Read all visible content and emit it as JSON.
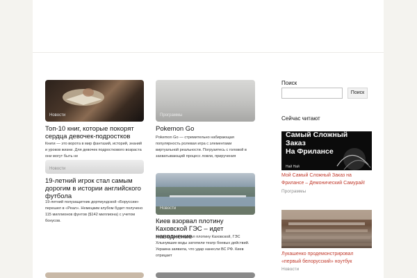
{
  "articles": [
    {
      "category": "Новости",
      "title": "Топ-10 книг, которые покорят сердца девочек-подростков",
      "excerpt": "Книги — это ворота в мир фантазий, историй, знаний и уроков жизни. Для девочек подросткового возраста они могут быть не"
    },
    {
      "category": "Программы",
      "title": "Pokemon Go",
      "excerpt": "Pokemon Go — стремительно набирающая популярность ролевая игра с элементами виртуальной реальности. Погрузитесь с головой в захватывающий процесс ловли, приручения"
    },
    {
      "category": "Новости",
      "title": "19-летний игрок стал самым дорогим в истории английского футбола",
      "excerpt": "19-летний полузащитник дортмундской «Боруссии» перешел в «Реал». Немецким клубом будет получено 115 миллионов фунтов ($142 миллиона) с учетом бонусов."
    },
    {
      "category": "Новости",
      "title": "Киев взорвал плотину Каховской ГЭС – идет наводнение",
      "excerpt": "Киев сегодня взорвал плотину Каховской, ГЭС Хлынувшие воды затопили театр боевых действий. Украина заявила, что удар нанесли ВС РФ. Киев отрицает"
    }
  ],
  "sidebar": {
    "search_heading": "Поиск",
    "search_placeholder": "",
    "search_button": "Поиск",
    "reading_heading": "Сейчас читают",
    "items": [
      {
        "image_text_line1": "Самый Сложный",
        "image_text_line2": "Заказ",
        "image_text_line3": "На Фрилансе",
        "image_caption": "Най Най",
        "title": "Мой Самый Сложный Заказ на Фрилансе – Демонический Самурай!",
        "category": "Программы"
      },
      {
        "title": "Лукашенко продемонстрировал «первый белорусский» ноутбук",
        "category": "Новости"
      }
    ]
  },
  "colors": {
    "accent_link": "#c0392b",
    "background": "#f4f3ef",
    "content": "#ffffff"
  }
}
